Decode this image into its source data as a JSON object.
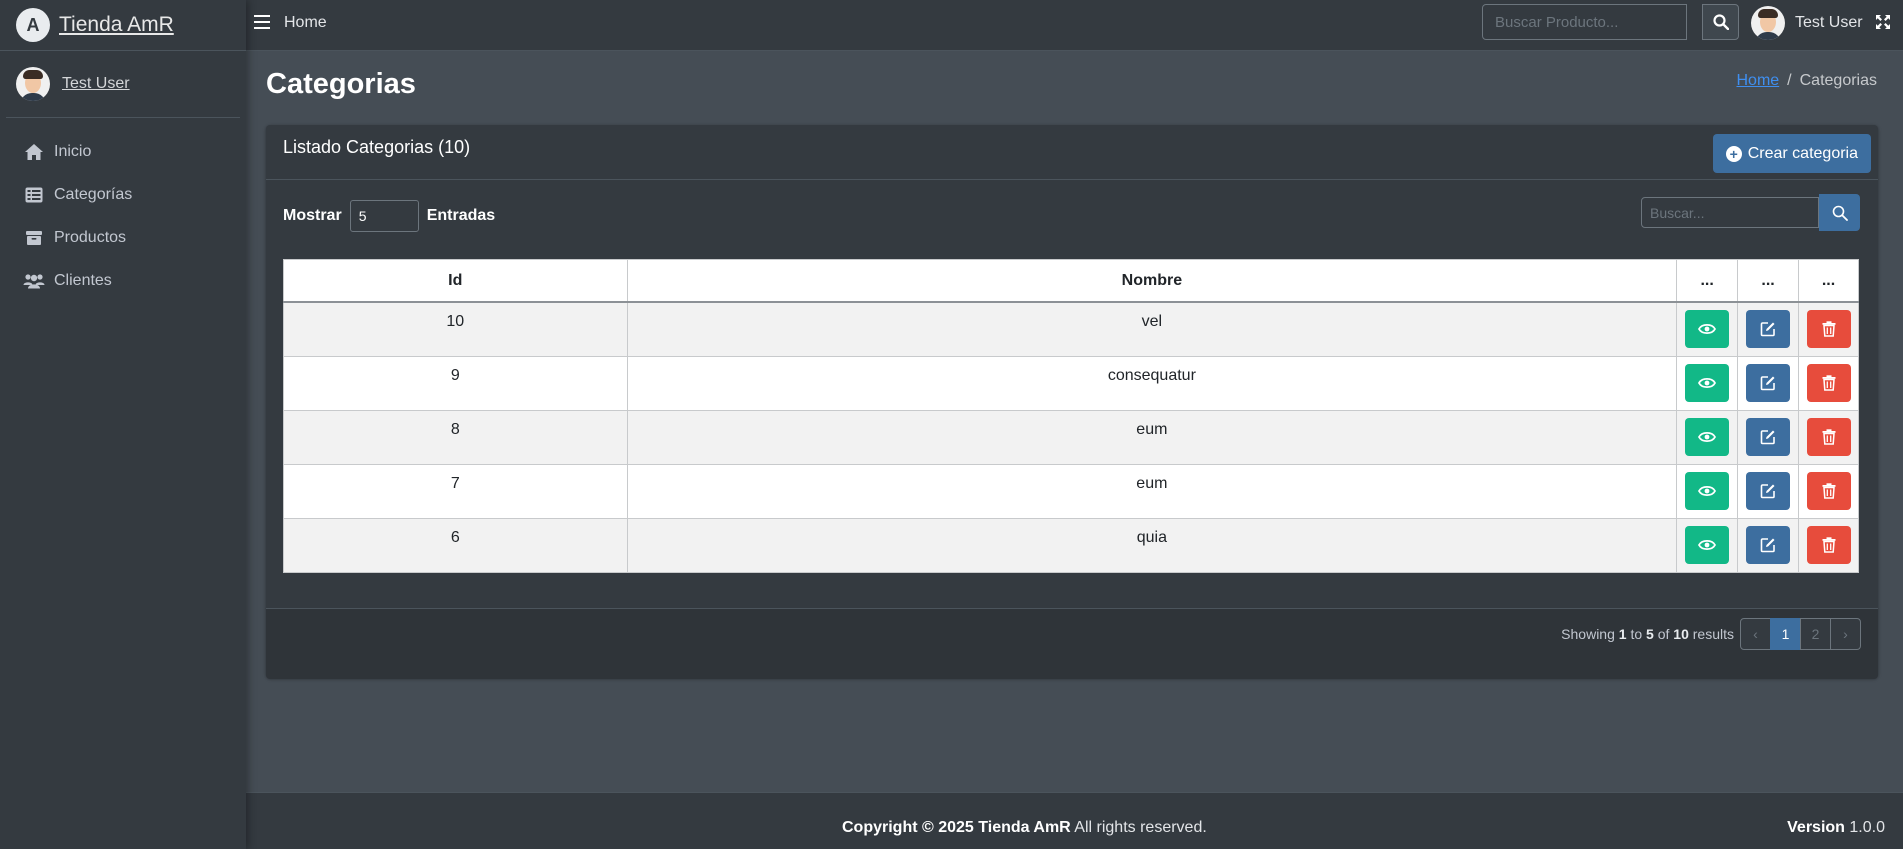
{
  "brand": {
    "name": "Tienda AmR",
    "logo_letter": "A"
  },
  "sidebar": {
    "user_name": "Test User",
    "items": [
      {
        "label": "Inicio",
        "icon": "home-icon"
      },
      {
        "label": "Categorías",
        "icon": "table-list-icon"
      },
      {
        "label": "Productos",
        "icon": "box-icon"
      },
      {
        "label": "Clientes",
        "icon": "users-icon"
      }
    ]
  },
  "topbar": {
    "home_label": "Home",
    "search_placeholder": "Buscar Producto...",
    "user_name": "Test User"
  },
  "page": {
    "title": "Categorias",
    "breadcrumb": {
      "home": "Home",
      "separator": "/",
      "current": "Categorias"
    }
  },
  "card": {
    "title": "Listado Categorias (10)",
    "create_button": "Crear categoria",
    "show_label": "Mostrar",
    "entries_value": "5",
    "entries_label": "Entradas",
    "search_placeholder": "Buscar..."
  },
  "table": {
    "headers": [
      "Id",
      "Nombre",
      "...",
      "...",
      "..."
    ],
    "rows": [
      {
        "id": "10",
        "nombre": "vel"
      },
      {
        "id": "9",
        "nombre": "consequatur"
      },
      {
        "id": "8",
        "nombre": "eum"
      },
      {
        "id": "7",
        "nombre": "eum"
      },
      {
        "id": "6",
        "nombre": "quia"
      }
    ]
  },
  "pagination": {
    "showing": "Showing",
    "from": "1",
    "to_word": "to",
    "to": "5",
    "of_word": "of",
    "total": "10",
    "results_word": "results",
    "prev": "‹",
    "pages": [
      "1",
      "2"
    ],
    "next": "›",
    "active_page": "1"
  },
  "footer": {
    "copyright": "Copyright © 2025 Tienda AmR",
    "rights": "All rights reserved.",
    "version_label": "Version",
    "version": "1.0.0"
  },
  "colors": {
    "sidebar_bg": "#343a40",
    "content_bg": "#454d55",
    "primary": "#3d6e9f",
    "success": "#12b887",
    "danger": "#e74c3c",
    "link": "#3f8ff0"
  }
}
